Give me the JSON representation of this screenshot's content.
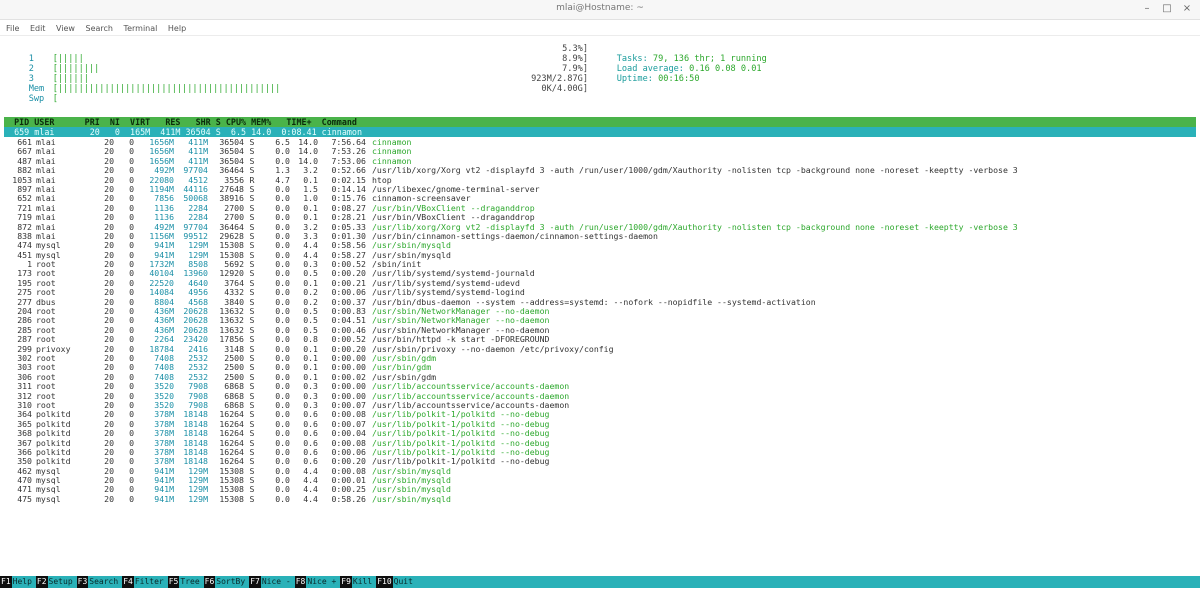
{
  "window": {
    "title": "mlai@Hostname: ~",
    "minimize": "–",
    "maximize": "□",
    "close": "×"
  },
  "menu": [
    "File",
    "Edit",
    "View",
    "Search",
    "Terminal",
    "Help"
  ],
  "meters": [
    {
      "label": "1",
      "bar": "[|||||",
      "value": "5.3%]"
    },
    {
      "label": "2",
      "bar": "[||||||||",
      "value": "8.9%]"
    },
    {
      "label": "3",
      "bar": "[||||||",
      "value": "7.9%]"
    },
    {
      "label": "Mem",
      "bar": "[|||||||||||||||||||||||||||||||||||||||||||",
      "value": "923M/2.87G]"
    },
    {
      "label": "Swp",
      "bar": "[",
      "value": "0K/4.00G]"
    }
  ],
  "info": {
    "tasks_label": "Tasks: ",
    "tasks_value": "79, 136 thr; 1 running",
    "load_label": "Load average: ",
    "load_value": "0.16 0.08 0.01",
    "uptime_label": "Uptime: ",
    "uptime_value": "00:16:50"
  },
  "header_row": "  PID USER      PRI  NI  VIRT   RES   SHR S CPU% MEM%   TIME+  Command",
  "selected_row": "  659 mlai       20   0  165M  411M 36504 S  6.5 14.0  0:08.41 cinnamon",
  "processes": [
    {
      "pid": "661",
      "user": "mlai",
      "pri": "20",
      "ni": "0",
      "virt": "1656M",
      "res": "411M",
      "shr": "36504",
      "s": "S",
      "cpu": "6.5",
      "mem": "14.0",
      "time": "7:56.64",
      "cmd": "cinnamon",
      "green": true
    },
    {
      "pid": "667",
      "user": "mlai",
      "pri": "20",
      "ni": "0",
      "virt": "1656M",
      "res": "411M",
      "shr": "36504",
      "s": "S",
      "cpu": "0.0",
      "mem": "14.0",
      "time": "7:53.26",
      "cmd": "cinnamon",
      "green": true
    },
    {
      "pid": "487",
      "user": "mlai",
      "pri": "20",
      "ni": "0",
      "virt": "1656M",
      "res": "411M",
      "shr": "36504",
      "s": "S",
      "cpu": "0.0",
      "mem": "14.0",
      "time": "7:53.06",
      "cmd": "cinnamon",
      "green": true
    },
    {
      "pid": "882",
      "user": "mlai",
      "pri": "20",
      "ni": "0",
      "virt": "492M",
      "res": "97704",
      "shr": "36464",
      "s": "S",
      "cpu": "1.3",
      "mem": "3.2",
      "time": "0:52.66",
      "cmd": "/usr/lib/xorg/Xorg vt2 -displayfd 3 -auth /run/user/1000/gdm/Xauthority -nolisten tcp -background none -noreset -keeptty -verbose 3",
      "green": false
    },
    {
      "pid": "1053",
      "user": "mlai",
      "pri": "20",
      "ni": "0",
      "virt": "22080",
      "res": "4512",
      "shr": "3556",
      "s": "R",
      "cpu": "4.7",
      "mem": "0.1",
      "time": "0:02.15",
      "cmd": "htop",
      "green": false
    },
    {
      "pid": "897",
      "user": "mlai",
      "pri": "20",
      "ni": "0",
      "virt": "1194M",
      "res": "44116",
      "shr": "27648",
      "s": "S",
      "cpu": "0.0",
      "mem": "1.5",
      "time": "0:14.14",
      "cmd": "/usr/libexec/gnome-terminal-server",
      "green": false
    },
    {
      "pid": "652",
      "user": "mlai",
      "pri": "20",
      "ni": "0",
      "virt": "7856",
      "res": "50068",
      "shr": "38916",
      "s": "S",
      "cpu": "0.0",
      "mem": "1.0",
      "time": "0:15.76",
      "cmd": "cinnamon-screensaver",
      "green": false
    },
    {
      "pid": "721",
      "user": "mlai",
      "pri": "20",
      "ni": "0",
      "virt": "1136",
      "res": "2284",
      "shr": "2700",
      "s": "S",
      "cpu": "0.0",
      "mem": "0.1",
      "time": "0:08.27",
      "cmd": "/usr/bin/VBoxClient --draganddrop",
      "green": true
    },
    {
      "pid": "719",
      "user": "mlai",
      "pri": "20",
      "ni": "0",
      "virt": "1136",
      "res": "2284",
      "shr": "2700",
      "s": "S",
      "cpu": "0.0",
      "mem": "0.1",
      "time": "0:28.21",
      "cmd": "/usr/bin/VBoxClient --draganddrop",
      "green": false
    },
    {
      "pid": "872",
      "user": "mlai",
      "pri": "20",
      "ni": "0",
      "virt": "492M",
      "res": "97704",
      "shr": "36464",
      "s": "S",
      "cpu": "0.0",
      "mem": "3.2",
      "time": "0:05.33",
      "cmd": "/usr/lib/xorg/Xorg vt2 -displayfd 3 -auth /run/user/1000/gdm/Xauthority -nolisten tcp -background none -noreset -keeptty -verbose 3",
      "green": true
    },
    {
      "pid": "838",
      "user": "mlai",
      "pri": "20",
      "ni": "0",
      "virt": "1156M",
      "res": "99512",
      "shr": "29628",
      "s": "S",
      "cpu": "0.0",
      "mem": "3.3",
      "time": "0:01.30",
      "cmd": "/usr/bin/cinnamon-settings-daemon/cinnamon-settings-daemon",
      "green": false
    },
    {
      "pid": "474",
      "user": "mysql",
      "pri": "20",
      "ni": "0",
      "virt": "941M",
      "res": "129M",
      "shr": "15308",
      "s": "S",
      "cpu": "0.0",
      "mem": "4.4",
      "time": "0:58.56",
      "cmd": "/usr/sbin/mysqld",
      "green": true
    },
    {
      "pid": "451",
      "user": "mysql",
      "pri": "20",
      "ni": "0",
      "virt": "941M",
      "res": "129M",
      "shr": "15308",
      "s": "S",
      "cpu": "0.0",
      "mem": "4.4",
      "time": "0:58.27",
      "cmd": "/usr/sbin/mysqld",
      "green": false
    },
    {
      "pid": "1",
      "user": "root",
      "pri": "20",
      "ni": "0",
      "virt": "1732M",
      "res": "8508",
      "shr": "5692",
      "s": "S",
      "cpu": "0.0",
      "mem": "0.3",
      "time": "0:00.52",
      "cmd": "/sbin/init",
      "green": false
    },
    {
      "pid": "173",
      "user": "root",
      "pri": "20",
      "ni": "0",
      "virt": "40104",
      "res": "13960",
      "shr": "12920",
      "s": "S",
      "cpu": "0.0",
      "mem": "0.5",
      "time": "0:00.20",
      "cmd": "/usr/lib/systemd/systemd-journald",
      "green": false
    },
    {
      "pid": "195",
      "user": "root",
      "pri": "20",
      "ni": "0",
      "virt": "22520",
      "res": "4640",
      "shr": "3764",
      "s": "S",
      "cpu": "0.0",
      "mem": "0.1",
      "time": "0:00.21",
      "cmd": "/usr/lib/systemd/systemd-udevd",
      "green": false
    },
    {
      "pid": "275",
      "user": "root",
      "pri": "20",
      "ni": "0",
      "virt": "14084",
      "res": "4956",
      "shr": "4332",
      "s": "S",
      "cpu": "0.0",
      "mem": "0.2",
      "time": "0:00.06",
      "cmd": "/usr/lib/systemd/systemd-logind",
      "green": false
    },
    {
      "pid": "277",
      "user": "dbus",
      "pri": "20",
      "ni": "0",
      "virt": "8804",
      "res": "4568",
      "shr": "3840",
      "s": "S",
      "cpu": "0.0",
      "mem": "0.2",
      "time": "0:00.37",
      "cmd": "/usr/bin/dbus-daemon --system --address=systemd: --nofork --nopidfile --systemd-activation",
      "green": false
    },
    {
      "pid": "204",
      "user": "root",
      "pri": "20",
      "ni": "0",
      "virt": "436M",
      "res": "20628",
      "shr": "13632",
      "s": "S",
      "cpu": "0.0",
      "mem": "0.5",
      "time": "0:00.83",
      "cmd": "/usr/sbin/NetworkManager --no-daemon",
      "green": true
    },
    {
      "pid": "286",
      "user": "root",
      "pri": "20",
      "ni": "0",
      "virt": "436M",
      "res": "20628",
      "shr": "13632",
      "s": "S",
      "cpu": "0.0",
      "mem": "0.5",
      "time": "0:04.51",
      "cmd": "/usr/sbin/NetworkManager --no-daemon",
      "green": true
    },
    {
      "pid": "285",
      "user": "root",
      "pri": "20",
      "ni": "0",
      "virt": "436M",
      "res": "20628",
      "shr": "13632",
      "s": "S",
      "cpu": "0.0",
      "mem": "0.5",
      "time": "0:00.46",
      "cmd": "/usr/sbin/NetworkManager --no-daemon",
      "green": false
    },
    {
      "pid": "287",
      "user": "root",
      "pri": "20",
      "ni": "0",
      "virt": "2264",
      "res": "23420",
      "shr": "17856",
      "s": "S",
      "cpu": "0.0",
      "mem": "0.8",
      "time": "0:00.52",
      "cmd": "/usr/bin/httpd -k start -DFOREGROUND",
      "green": false
    },
    {
      "pid": "299",
      "user": "privoxy",
      "pri": "20",
      "ni": "0",
      "virt": "18784",
      "res": "2416",
      "shr": "3148",
      "s": "S",
      "cpu": "0.0",
      "mem": "0.1",
      "time": "0:00.20",
      "cmd": "/usr/sbin/privoxy --no-daemon /etc/privoxy/config",
      "green": false
    },
    {
      "pid": "302",
      "user": "root",
      "pri": "20",
      "ni": "0",
      "virt": "7408",
      "res": "2532",
      "shr": "2500",
      "s": "S",
      "cpu": "0.0",
      "mem": "0.1",
      "time": "0:00.00",
      "cmd": "/usr/sbin/gdm",
      "green": true
    },
    {
      "pid": "303",
      "user": "root",
      "pri": "20",
      "ni": "0",
      "virt": "7408",
      "res": "2532",
      "shr": "2500",
      "s": "S",
      "cpu": "0.0",
      "mem": "0.1",
      "time": "0:00.00",
      "cmd": "/usr/bin/gdm",
      "green": true
    },
    {
      "pid": "306",
      "user": "root",
      "pri": "20",
      "ni": "0",
      "virt": "7408",
      "res": "2532",
      "shr": "2500",
      "s": "S",
      "cpu": "0.0",
      "mem": "0.1",
      "time": "0:00.02",
      "cmd": "/usr/sbin/gdm",
      "green": false
    },
    {
      "pid": "311",
      "user": "root",
      "pri": "20",
      "ni": "0",
      "virt": "3520",
      "res": "7908",
      "shr": "6868",
      "s": "S",
      "cpu": "0.0",
      "mem": "0.3",
      "time": "0:00.00",
      "cmd": "/usr/lib/accountsservice/accounts-daemon",
      "green": true
    },
    {
      "pid": "312",
      "user": "root",
      "pri": "20",
      "ni": "0",
      "virt": "3520",
      "res": "7908",
      "shr": "6868",
      "s": "S",
      "cpu": "0.0",
      "mem": "0.3",
      "time": "0:00.00",
      "cmd": "/usr/lib/accountsservice/accounts-daemon",
      "green": true
    },
    {
      "pid": "310",
      "user": "root",
      "pri": "20",
      "ni": "0",
      "virt": "3520",
      "res": "7908",
      "shr": "6868",
      "s": "S",
      "cpu": "0.0",
      "mem": "0.3",
      "time": "0:00.07",
      "cmd": "/usr/lib/accountsservice/accounts-daemon",
      "green": false
    },
    {
      "pid": "364",
      "user": "polkitd",
      "pri": "20",
      "ni": "0",
      "virt": "378M",
      "res": "18148",
      "shr": "16264",
      "s": "S",
      "cpu": "0.0",
      "mem": "0.6",
      "time": "0:00.08",
      "cmd": "/usr/lib/polkit-1/polkitd --no-debug",
      "green": true
    },
    {
      "pid": "365",
      "user": "polkitd",
      "pri": "20",
      "ni": "0",
      "virt": "378M",
      "res": "18148",
      "shr": "16264",
      "s": "S",
      "cpu": "0.0",
      "mem": "0.6",
      "time": "0:00.07",
      "cmd": "/usr/lib/polkit-1/polkitd --no-debug",
      "green": true
    },
    {
      "pid": "368",
      "user": "polkitd",
      "pri": "20",
      "ni": "0",
      "virt": "378M",
      "res": "18148",
      "shr": "16264",
      "s": "S",
      "cpu": "0.0",
      "mem": "0.6",
      "time": "0:00.04",
      "cmd": "/usr/lib/polkit-1/polkitd --no-debug",
      "green": true
    },
    {
      "pid": "367",
      "user": "polkitd",
      "pri": "20",
      "ni": "0",
      "virt": "378M",
      "res": "18148",
      "shr": "16264",
      "s": "S",
      "cpu": "0.0",
      "mem": "0.6",
      "time": "0:00.08",
      "cmd": "/usr/lib/polkit-1/polkitd --no-debug",
      "green": true
    },
    {
      "pid": "366",
      "user": "polkitd",
      "pri": "20",
      "ni": "0",
      "virt": "378M",
      "res": "18148",
      "shr": "16264",
      "s": "S",
      "cpu": "0.0",
      "mem": "0.6",
      "time": "0:00.06",
      "cmd": "/usr/lib/polkit-1/polkitd --no-debug",
      "green": true
    },
    {
      "pid": "350",
      "user": "polkitd",
      "pri": "20",
      "ni": "0",
      "virt": "378M",
      "res": "18148",
      "shr": "16264",
      "s": "S",
      "cpu": "0.0",
      "mem": "0.6",
      "time": "0:00.20",
      "cmd": "/usr/lib/polkit-1/polkitd --no-debug",
      "green": false
    },
    {
      "pid": "462",
      "user": "mysql",
      "pri": "20",
      "ni": "0",
      "virt": "941M",
      "res": "129M",
      "shr": "15308",
      "s": "S",
      "cpu": "0.0",
      "mem": "4.4",
      "time": "0:00.08",
      "cmd": "/usr/sbin/mysqld",
      "green": true
    },
    {
      "pid": "470",
      "user": "mysql",
      "pri": "20",
      "ni": "0",
      "virt": "941M",
      "res": "129M",
      "shr": "15308",
      "s": "S",
      "cpu": "0.0",
      "mem": "4.4",
      "time": "0:00.01",
      "cmd": "/usr/sbin/mysqld",
      "green": true
    },
    {
      "pid": "471",
      "user": "mysql",
      "pri": "20",
      "ni": "0",
      "virt": "941M",
      "res": "129M",
      "shr": "15308",
      "s": "S",
      "cpu": "0.0",
      "mem": "4.4",
      "time": "0:00.25",
      "cmd": "/usr/sbin/mysqld",
      "green": true
    },
    {
      "pid": "475",
      "user": "mysql",
      "pri": "20",
      "ni": "0",
      "virt": "941M",
      "res": "129M",
      "shr": "15308",
      "s": "S",
      "cpu": "0.0",
      "mem": "4.4",
      "time": "0:58.26",
      "cmd": "/usr/sbin/mysqld",
      "green": true
    }
  ],
  "footer": [
    {
      "key": "F1",
      "label": "Help"
    },
    {
      "key": "F2",
      "label": "Setup"
    },
    {
      "key": "F3",
      "label": "Search"
    },
    {
      "key": "F4",
      "label": "Filter"
    },
    {
      "key": "F5",
      "label": "Tree"
    },
    {
      "key": "F6",
      "label": "SortBy"
    },
    {
      "key": "F7",
      "label": "Nice -"
    },
    {
      "key": "F8",
      "label": "Nice +"
    },
    {
      "key": "F9",
      "label": "Kill"
    },
    {
      "key": "F10",
      "label": "Quit"
    }
  ]
}
